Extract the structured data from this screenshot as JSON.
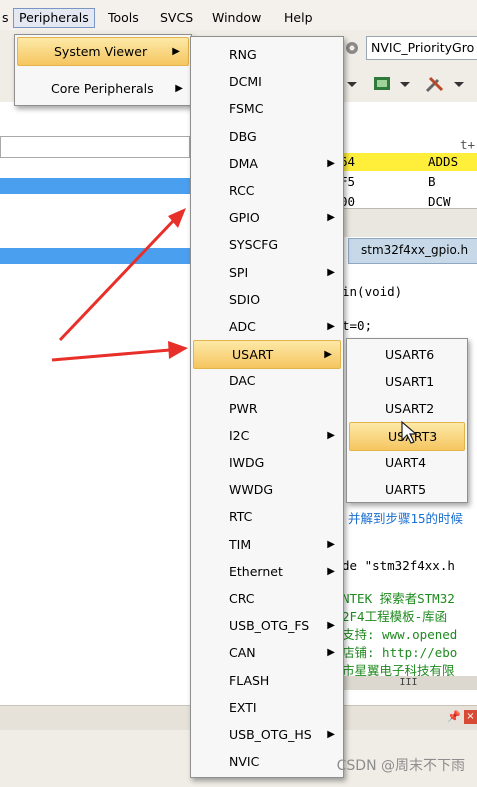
{
  "menubar": {
    "items": [
      "Peripherals",
      "Tools",
      "SVCS",
      "Window",
      "Help"
    ]
  },
  "toolbar": {
    "combo_value": "NVIC_PriorityGro"
  },
  "peripherals_menu": {
    "items": [
      {
        "label": "System Viewer",
        "has_submenu": true,
        "selected": true
      },
      {
        "label": "Core Peripherals",
        "has_submenu": true,
        "selected": false
      }
    ]
  },
  "system_viewer_menu": {
    "items": [
      {
        "label": "RNG",
        "has_submenu": false
      },
      {
        "label": "DCMI",
        "has_submenu": false
      },
      {
        "label": "FSMC",
        "has_submenu": false
      },
      {
        "label": "DBG",
        "has_submenu": false
      },
      {
        "label": "DMA",
        "has_submenu": true
      },
      {
        "label": "RCC",
        "has_submenu": false
      },
      {
        "label": "GPIO",
        "has_submenu": true
      },
      {
        "label": "SYSCFG",
        "has_submenu": false
      },
      {
        "label": "SPI",
        "has_submenu": true
      },
      {
        "label": "SDIO",
        "has_submenu": false
      },
      {
        "label": "ADC",
        "has_submenu": true
      },
      {
        "label": "USART",
        "has_submenu": true,
        "selected": true
      },
      {
        "label": "DAC",
        "has_submenu": false
      },
      {
        "label": "PWR",
        "has_submenu": false
      },
      {
        "label": "I2C",
        "has_submenu": true
      },
      {
        "label": "IWDG",
        "has_submenu": false
      },
      {
        "label": "WWDG",
        "has_submenu": false
      },
      {
        "label": "RTC",
        "has_submenu": false
      },
      {
        "label": "TIM",
        "has_submenu": true
      },
      {
        "label": "Ethernet",
        "has_submenu": true
      },
      {
        "label": "CRC",
        "has_submenu": false
      },
      {
        "label": "USB_OTG_FS",
        "has_submenu": true
      },
      {
        "label": "CAN",
        "has_submenu": true
      },
      {
        "label": "FLASH",
        "has_submenu": false
      },
      {
        "label": "EXTI",
        "has_submenu": false
      },
      {
        "label": "USB_OTG_HS",
        "has_submenu": true
      },
      {
        "label": "NVIC",
        "has_submenu": false
      }
    ]
  },
  "usart_menu": {
    "items": [
      {
        "label": "USART6",
        "selected": false
      },
      {
        "label": "USART1",
        "selected": false
      },
      {
        "label": "USART2",
        "selected": false
      },
      {
        "label": "USART3",
        "selected": true
      },
      {
        "label": "UART4",
        "selected": false
      },
      {
        "label": "UART5",
        "selected": false
      }
    ]
  },
  "editor": {
    "tab_label": "stm32f4xx_gpio.h",
    "disasm": [
      {
        "addr": "t+",
        "op": ""
      },
      {
        "addr": "64",
        "op": "ADDS"
      },
      {
        "addr": "F5",
        "op": "B"
      },
      {
        "addr": "00",
        "op": "DCW"
      }
    ],
    "code_lines": [
      "in(void)",
      "t=0;",
      "",
      "并解到步骤15的时候",
      "de \"stm32f4xx.h",
      "NTEK 探索者STM32",
      "2F4工程模板-库函",
      "支持: www.opened",
      "店铺: http://ebo",
      "市星翼电子科技有限",
      "'"
    ],
    "scroll_label": "III"
  },
  "watermark": "CSDN @周末不下雨",
  "colors": {
    "selection_gradient_top": "#fde9a8",
    "selection_gradient_bottom": "#f5c55f",
    "highlight_blue": "#4aa0ee",
    "highlight_yellow": "#ffef3a",
    "arrow_red": "#e8302b"
  }
}
